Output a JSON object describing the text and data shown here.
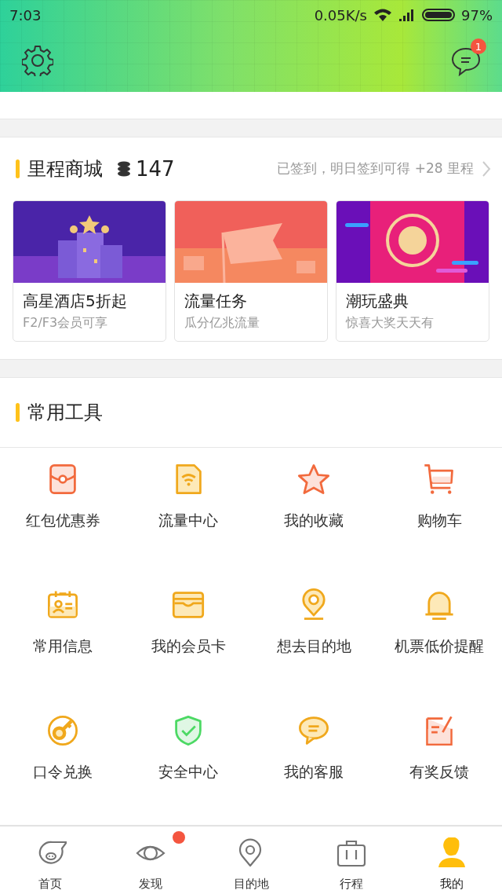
{
  "status_bar": {
    "time": "7:03",
    "speed": "0.05K/s",
    "battery": "97%"
  },
  "header": {
    "message_badge": "1"
  },
  "mileage_mall": {
    "title": "里程商城",
    "points": "147",
    "checkin": "已签到，明日签到可得 +28 里程",
    "promos": [
      {
        "kind": "picture",
        "title": "高星酒店5折起",
        "subtitle": "F2/F3会员可享"
      },
      {
        "kind": "picture",
        "title": "流量任务",
        "subtitle": "瓜分亿兆流量"
      },
      {
        "kind": "picture",
        "title": "潮玩盛典",
        "subtitle": "惊喜大奖天天有"
      }
    ]
  },
  "tools": {
    "title": "常用工具",
    "items": [
      {
        "label": "红包优惠券"
      },
      {
        "label": "流量中心"
      },
      {
        "label": "我的收藏"
      },
      {
        "label": "购物车"
      },
      {
        "label": "常用信息"
      },
      {
        "label": "我的会员卡"
      },
      {
        "label": "想去目的地"
      },
      {
        "label": "机票低价提醒"
      },
      {
        "label": "口令兑换"
      },
      {
        "label": "安全中心"
      },
      {
        "label": "我的客服"
      },
      {
        "label": "有奖反馈"
      }
    ]
  },
  "tab_bar": [
    {
      "label": "首页",
      "selected": false,
      "dot": false
    },
    {
      "label": "发现",
      "selected": false,
      "dot": true
    },
    {
      "label": "目的地",
      "selected": false,
      "dot": false
    },
    {
      "label": "行程",
      "selected": false,
      "dot": false
    },
    {
      "label": "我的",
      "selected": true,
      "dot": false
    }
  ]
}
